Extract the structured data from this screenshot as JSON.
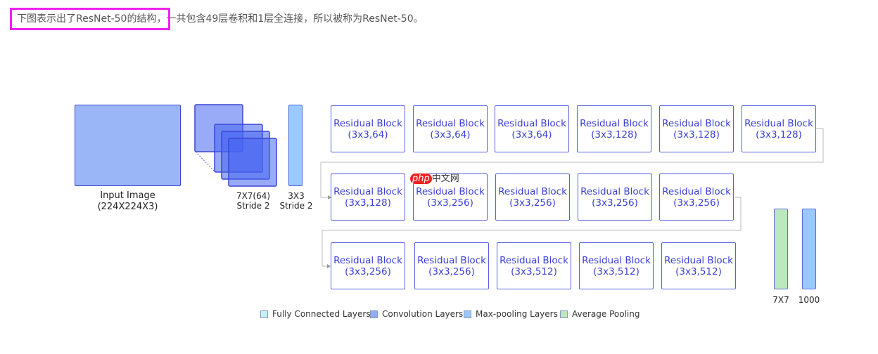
{
  "intro": {
    "highlighted": "下图表示出了ResNet-50的结构，",
    "rest": "一共包含49层卷积和1层全连接，所以被称为ResNet-50。"
  },
  "input": {
    "label1": "Input Image",
    "label2": "(224X224X3)"
  },
  "conv": {
    "label1": "7X7(64)",
    "label2": "Stride 2"
  },
  "maxpool": {
    "label1": "3X3",
    "label2": "Stride 2"
  },
  "blocks": [
    [
      {
        "t": "Residual Block",
        "p": "(3x3,64)"
      },
      {
        "t": "Residual Block",
        "p": "(3x3,64)"
      },
      {
        "t": "Residual Block",
        "p": "(3x3,64)"
      },
      {
        "t": "Residual Block",
        "p": "(3x3,128)"
      },
      {
        "t": "Residual Block",
        "p": "(3x3,128)"
      },
      {
        "t": "Residual Block",
        "p": "(3x3,128)"
      }
    ],
    [
      {
        "t": "Residual Block",
        "p": "(3x3,128)"
      },
      {
        "t": "Residual Block",
        "p": "(3x3,256)"
      },
      {
        "t": "Residual Block",
        "p": "(3x3,256)"
      },
      {
        "t": "Residual Block",
        "p": "(3x3,256)"
      },
      {
        "t": "Residual Block",
        "p": "(3x3,256)"
      }
    ],
    [
      {
        "t": "Residual Block",
        "p": "(3x3,256)"
      },
      {
        "t": "Residual Block",
        "p": "(3x3,256)"
      },
      {
        "t": "Residual Block",
        "p": "(3x3,512)"
      },
      {
        "t": "Residual Block",
        "p": "(3x3,512)"
      },
      {
        "t": "Residual Block",
        "p": "(3x3,512)"
      }
    ]
  ],
  "avgpool": {
    "label": "7X7"
  },
  "fc": {
    "label": "1000"
  },
  "legend": [
    {
      "label": "Fully Connected Layers",
      "color": "#c4f1f6"
    },
    {
      "label": "Convolution Layers",
      "color": "#93acf5"
    },
    {
      "label": "Max-pooling Layers",
      "color": "#99c9ff"
    },
    {
      "label": "Average Pooling",
      "color": "#bde8bd"
    }
  ],
  "watermark": {
    "logo": "php",
    "text": "中文网"
  }
}
